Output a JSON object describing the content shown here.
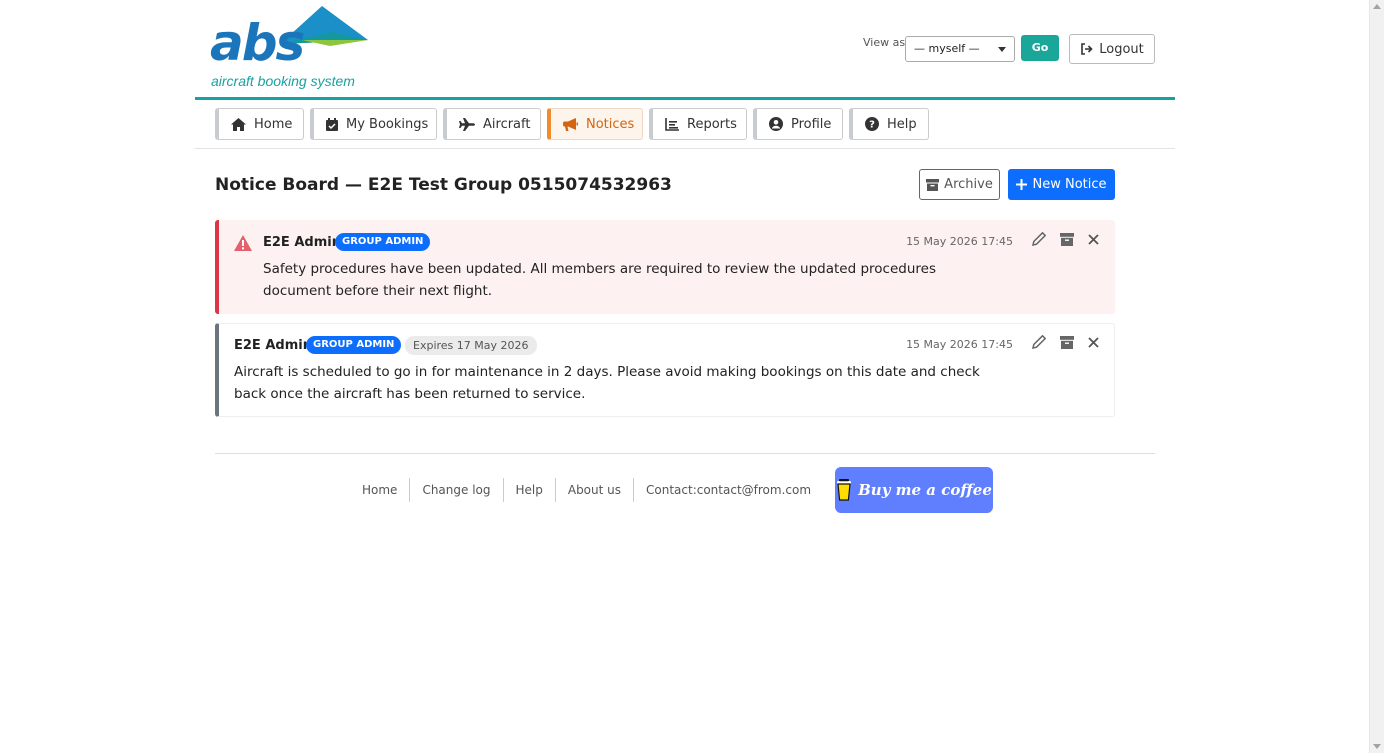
{
  "brand": {
    "logo_word": "abs",
    "logo_tagline": "aircraft booking system"
  },
  "header": {
    "view_as_label": "View as",
    "view_as_selected": "— myself —",
    "go_label": "Go",
    "logout_label": "Logout"
  },
  "nav": {
    "tabs": [
      {
        "label": "Home",
        "icon": "home-icon"
      },
      {
        "label": "My Bookings",
        "icon": "calendar-icon"
      },
      {
        "label": "Aircraft",
        "icon": "plane-icon"
      },
      {
        "label": "Notices",
        "icon": "megaphone-icon",
        "active": true
      },
      {
        "label": "Reports",
        "icon": "chart-icon"
      },
      {
        "label": "Profile",
        "icon": "user-icon"
      },
      {
        "label": "Help",
        "icon": "question-icon"
      }
    ]
  },
  "main": {
    "title": "Notice Board — E2E Test Group 0515074532963",
    "archive_label": "Archive",
    "new_notice_label": "New Notice"
  },
  "notices": [
    {
      "author": "E2E Admin",
      "role": "GROUP ADMIN",
      "date": "15 May 2026 17:45",
      "body": "Safety procedures have been updated. All members are required to review the updated procedures document before their next flight.",
      "severity": "warning"
    },
    {
      "author": "E2E Admin",
      "role": "GROUP ADMIN",
      "expires": "Expires 17 May 2026",
      "date": "15 May 2026 17:45",
      "body": "Aircraft is scheduled to go in for maintenance in 2 days. Please avoid making bookings on this date and check back once the aircraft has been returned to service.",
      "severity": "normal"
    }
  ],
  "footer": {
    "links": [
      "Home",
      "Change log",
      "Help",
      "About us",
      "Contact:contact@from.com"
    ],
    "coffee_label": "Buy me a coffee"
  },
  "colors": {
    "teal": "#17a2a2",
    "primary": "#0d6efd",
    "danger": "#dc3545",
    "active_tab": "#f08c2b",
    "coffee": "#5f7fff"
  }
}
